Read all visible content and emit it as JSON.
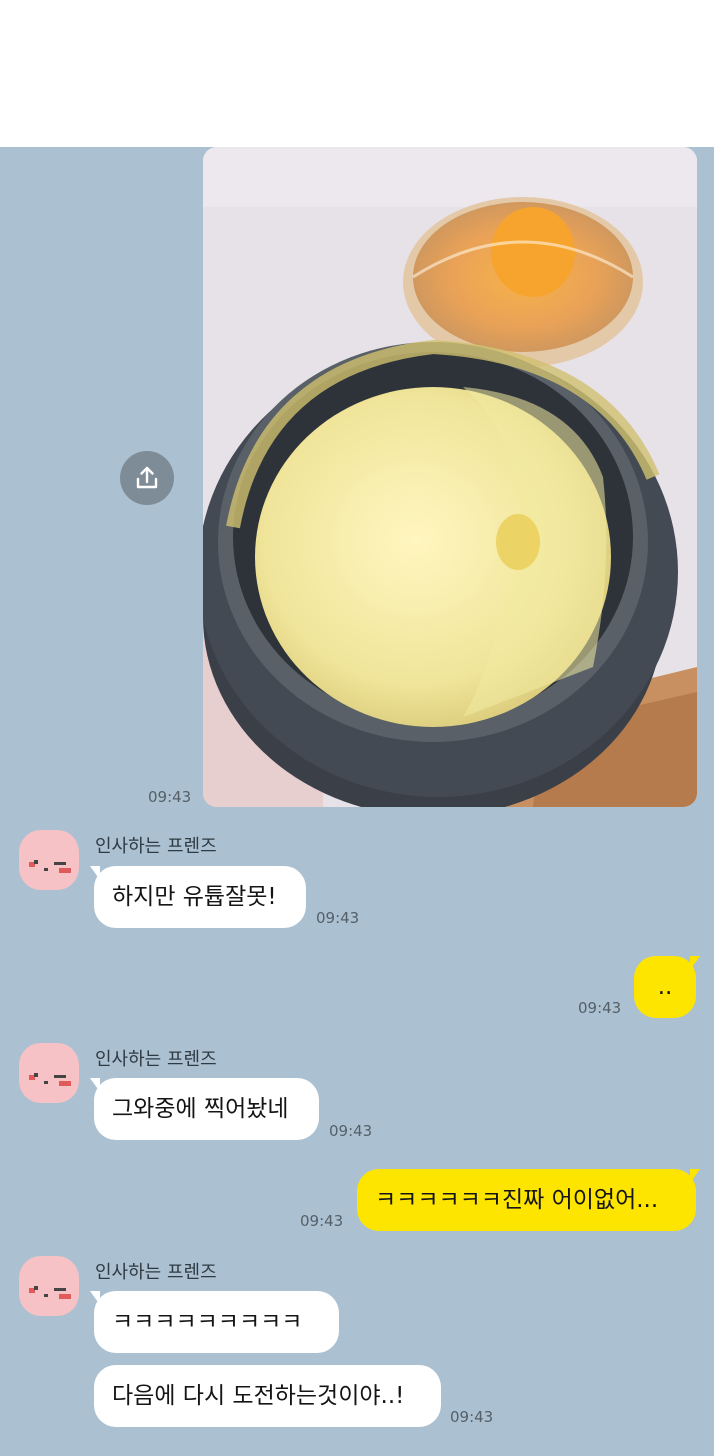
{
  "colors": {
    "chat_background": "#abc1d1",
    "incoming_bubble": "#ffffff",
    "outgoing_bubble": "#fee500",
    "avatar": "#f6c2c6"
  },
  "photo_message": {
    "icon": "share-icon",
    "time": "09:43",
    "image_description_icon": "photo-of-steamed-egg"
  },
  "messages": [
    {
      "sender": "인사하는 프렌즈",
      "text": "하지만 유튭잘못!",
      "time": "09:43"
    },
    {
      "text": "..",
      "time": "09:43"
    },
    {
      "sender": "인사하는 프렌즈",
      "text": "그와중에 찍어놨네",
      "time": "09:43"
    },
    {
      "text": "ㅋㅋㅋㅋㅋㅋ진짜 어이없어...",
      "time": "09:43"
    },
    {
      "sender": "인사하는 프렌즈",
      "text": "ㅋㅋㅋㅋㅋㅋㅋㅋㅋ"
    },
    {
      "text": "다음에 다시 도전하는것이야..!",
      "time": "09:43"
    }
  ]
}
